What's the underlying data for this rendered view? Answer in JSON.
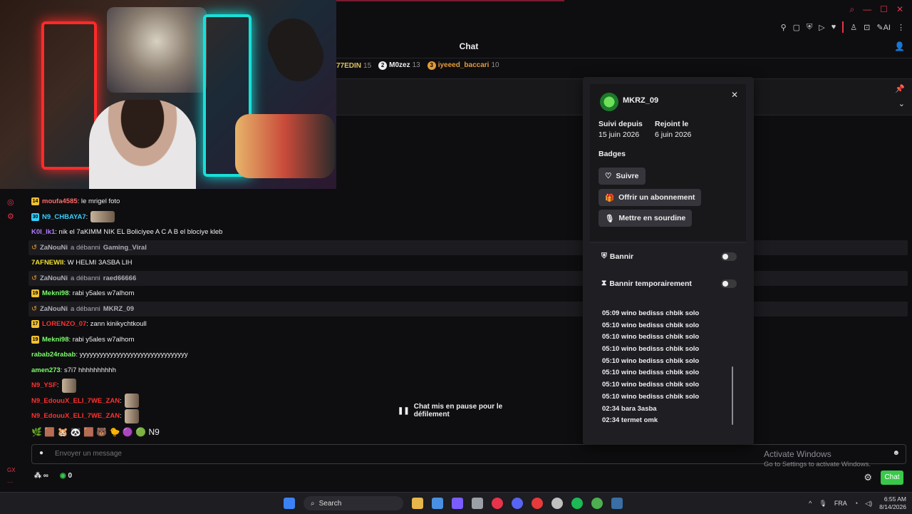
{
  "chat_header": {
    "title": "Chat"
  },
  "gifters": [
    {
      "name": "77EDIN",
      "count": "15",
      "rank": "",
      "color": "#e0c060"
    },
    {
      "name": "M0zez",
      "count": "13",
      "rank": "2",
      "color": "#efeff1"
    },
    {
      "name": "iyeeed_baccari",
      "count": "10",
      "rank": "3",
      "color": "#e39a3c"
    }
  ],
  "messages": [
    {
      "type": "user",
      "badge": "14",
      "badge_color": "#f0c030",
      "user": "moufa4585",
      "user_color": "#ff6a6a",
      "text": ": le mrigel foto"
    },
    {
      "type": "user",
      "badge": "30",
      "badge_color": "#35d0ff",
      "user": "N9_CHBAYA7",
      "user_color": "#35d0ff",
      "text": ":",
      "emote": true
    },
    {
      "type": "user",
      "badge": "",
      "user": "K0I_lk1",
      "user_color": "#b57cff",
      "text": ": nik el 7aKIMM NIK EL Boliciyee A C A B el blociye kleb"
    },
    {
      "type": "sys",
      "actor": "ZaNouNi",
      "action": "a débanni",
      "target": "Gaming_Viral"
    },
    {
      "type": "user",
      "badge": "",
      "user": "7AFNEWII",
      "user_color": "#f0e030",
      "text": ": W HELMI 3ASBA LIH"
    },
    {
      "type": "sys",
      "actor": "ZaNouNi",
      "action": "a débanni",
      "target": "raed66666"
    },
    {
      "type": "user",
      "badge": "19",
      "badge_color": "#f0c030",
      "user": "Mekni98",
      "user_color": "#7cff6a",
      "text": ": rabi y5ales w7alhom"
    },
    {
      "type": "sys",
      "actor": "ZaNouNi",
      "action": "a débanni",
      "target": "MKRZ_09"
    },
    {
      "type": "user",
      "badge": "17",
      "badge_color": "#f0c030",
      "user": "LORENZO_07",
      "user_color": "#ff3030",
      "text": ": zann kinikychtkoull"
    },
    {
      "type": "user",
      "badge": "19",
      "badge_color": "#f0c030",
      "user": "Mekni98",
      "user_color": "#7cff6a",
      "text": ": rabi y5ales w7alhom"
    },
    {
      "type": "user",
      "badge": "",
      "user": "rabab24rabab",
      "user_color": "#7cff6a",
      "text": ": yyyyyyyyyyyyyyyyyyyyyyyyyyyyyyyy"
    },
    {
      "type": "user",
      "badge": "",
      "user": "amen273",
      "user_color": "#7cff6a",
      "text": ": s7i7 hhhhhhhhhh"
    },
    {
      "type": "user",
      "badge": "",
      "user": "N9_YSF",
      "user_color": "#ff3030",
      "text": ":",
      "emote_sq": true
    },
    {
      "type": "user",
      "badge": "",
      "user": "N9_EdouuX_ELI_7WE_ZAN",
      "user_color": "#ff3030",
      "text": ":",
      "emote_sq": true
    },
    {
      "type": "user",
      "badge": "",
      "user": "N9_EdouuX_ELI_7WE_ZAN",
      "user_color": "#ff3030",
      "text": ":",
      "emote_sq": true
    }
  ],
  "emote_row": "🌿 🟫 🐹 🐼 🟫 🐻 🐤 🟣 🟢 N9",
  "paused": {
    "label": "Chat mis en pause pour le défilement"
  },
  "input": {
    "placeholder": "Envoyer un message"
  },
  "bottom": {
    "viewers": "∞",
    "points": "0",
    "chat_button": "Chat"
  },
  "activate_windows": {
    "line1": "Activate Windows",
    "line2": "Go to Settings to activate Windows."
  },
  "user_card": {
    "username": "MKRZ_09",
    "followed_label": "Suivi depuis",
    "followed_value": "15 juin 2026",
    "joined_label": "Rejoint le",
    "joined_value": "6 juin 2026",
    "badges_label": "Badges",
    "follow_button": "Suivre",
    "gift_button": "Offrir un abonnement",
    "mute_button": "Mettre en sourdine",
    "ban_label": "Bannir",
    "timeout_label": "Bannir temporairement",
    "history": [
      "05:09 wino bedisss chbik solo",
      "05:10 wino bedisss chbik solo",
      "05:10 wino bedisss chbik solo",
      "05:10 wino bedisss chbik solo",
      "05:10 wino bedisss chbik solo",
      "05:10 wino bedisss chbik solo",
      "05:10 wino bedisss chbik solo",
      "05:10 wino bedisss chbik solo",
      "02:34 bara 3asba",
      "02:34 termet omk"
    ]
  },
  "taskbar": {
    "search": "Search",
    "lang": "FRA",
    "time": "6:55 AM",
    "date": "8/14/2026"
  },
  "colors": {
    "accent": "#e8344a",
    "chat_green": "#3ac84a",
    "background": "#0e0e10"
  }
}
